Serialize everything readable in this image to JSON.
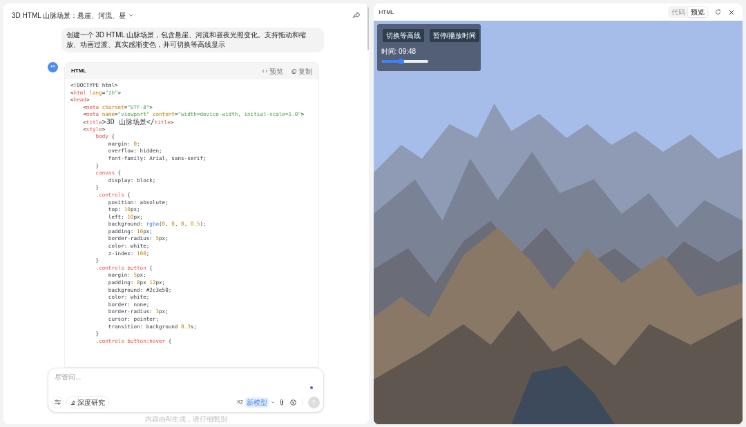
{
  "chat": {
    "title": "3D HTML 山脉场景：悬崖、河流、昼",
    "user_message": "创建一个 3D HTML 山脉场景，包含悬崖、河流和昼夜光照变化。支持拖动和缩放、动画过渡、真实感渐变色，并可切换等高线显示",
    "code_block": {
      "language": "HTML",
      "actions": [
        "预览",
        "复制"
      ],
      "lines": [
        [
          {
            "text": "<!DOCTYPE html>",
            "kind": "plain"
          }
        ],
        [
          {
            "text": "<",
            "kind": "plain"
          },
          {
            "text": "html",
            "kind": "tag"
          },
          {
            "text": " lang",
            "kind": "attr"
          },
          {
            "text": "=",
            "kind": "plain"
          },
          {
            "text": "\"zh\"",
            "kind": "string"
          },
          {
            "text": ">",
            "kind": "plain"
          }
        ],
        [
          {
            "text": "<",
            "kind": "plain"
          },
          {
            "text": "head",
            "kind": "tag"
          },
          {
            "text": ">",
            "kind": "plain"
          }
        ],
        [
          {
            "text": "    <",
            "kind": "plain"
          },
          {
            "text": "meta",
            "kind": "tag"
          },
          {
            "text": " charset",
            "kind": "attr"
          },
          {
            "text": "=",
            "kind": "plain"
          },
          {
            "text": "\"UTF-8\"",
            "kind": "string"
          },
          {
            "text": ">",
            "kind": "plain"
          }
        ],
        [
          {
            "text": "    <",
            "kind": "plain"
          },
          {
            "text": "meta",
            "kind": "tag"
          },
          {
            "text": " name",
            "kind": "attr"
          },
          {
            "text": "=",
            "kind": "plain"
          },
          {
            "text": "\"viewport\"",
            "kind": "string"
          },
          {
            "text": " content",
            "kind": "attr"
          },
          {
            "text": "=",
            "kind": "plain"
          },
          {
            "text": "\"width=device-width, initial-scale=1.0\"",
            "kind": "string"
          },
          {
            "text": ">",
            "kind": "plain"
          }
        ],
        [
          {
            "text": "    <",
            "kind": "plain"
          },
          {
            "text": "title",
            "kind": "tag"
          },
          {
            "text": ">3D 山脉场景</",
            "kind": "plain"
          },
          {
            "text": "title",
            "kind": "tag"
          },
          {
            "text": ">",
            "kind": "plain"
          }
        ],
        [
          {
            "text": "    <",
            "kind": "plain"
          },
          {
            "text": "style",
            "kind": "tag"
          },
          {
            "text": ">",
            "kind": "plain"
          }
        ],
        [
          {
            "text": "        body",
            "kind": "selector"
          },
          {
            "text": " {",
            "kind": "plain"
          }
        ],
        [
          {
            "text": "            margin: ",
            "kind": "plain"
          },
          {
            "text": "0",
            "kind": "number"
          },
          {
            "text": ";",
            "kind": "plain"
          }
        ],
        [
          {
            "text": "            overflow: hidden;",
            "kind": "plain"
          }
        ],
        [
          {
            "text": "            font-family: Arial, sans-serif;",
            "kind": "plain"
          }
        ],
        [
          {
            "text": "        }",
            "kind": "plain"
          }
        ],
        [
          {
            "text": "        canvas",
            "kind": "selector"
          },
          {
            "text": " {",
            "kind": "plain"
          }
        ],
        [
          {
            "text": "            display: block;",
            "kind": "plain"
          }
        ],
        [
          {
            "text": "        }",
            "kind": "plain"
          }
        ],
        [
          {
            "text": "        .controls",
            "kind": "selector"
          },
          {
            "text": " {",
            "kind": "plain"
          }
        ],
        [
          {
            "text": "            position: absolute;",
            "kind": "plain"
          }
        ],
        [
          {
            "text": "            top: ",
            "kind": "plain"
          },
          {
            "text": "10",
            "kind": "number"
          },
          {
            "text": "px;",
            "kind": "plain"
          }
        ],
        [
          {
            "text": "            left: ",
            "kind": "plain"
          },
          {
            "text": "10",
            "kind": "number"
          },
          {
            "text": "px;",
            "kind": "plain"
          }
        ],
        [
          {
            "text": "            background: ",
            "kind": "plain"
          },
          {
            "text": "rgba",
            "kind": "function"
          },
          {
            "text": "(",
            "kind": "plain"
          },
          {
            "text": "0",
            "kind": "number"
          },
          {
            "text": ", ",
            "kind": "plain"
          },
          {
            "text": "0",
            "kind": "number"
          },
          {
            "text": ", ",
            "kind": "plain"
          },
          {
            "text": "0",
            "kind": "number"
          },
          {
            "text": ", ",
            "kind": "plain"
          },
          {
            "text": "0.5",
            "kind": "number"
          },
          {
            "text": ");",
            "kind": "plain"
          }
        ],
        [
          {
            "text": "            padding: ",
            "kind": "plain"
          },
          {
            "text": "10",
            "kind": "number"
          },
          {
            "text": "px;",
            "kind": "plain"
          }
        ],
        [
          {
            "text": "            border-radius: ",
            "kind": "plain"
          },
          {
            "text": "5",
            "kind": "number"
          },
          {
            "text": "px;",
            "kind": "plain"
          }
        ],
        [
          {
            "text": "            color: white;",
            "kind": "plain"
          }
        ],
        [
          {
            "text": "            z-index: ",
            "kind": "plain"
          },
          {
            "text": "100",
            "kind": "number"
          },
          {
            "text": ";",
            "kind": "plain"
          }
        ],
        [
          {
            "text": "        }",
            "kind": "plain"
          }
        ],
        [
          {
            "text": "        .controls button",
            "kind": "selector"
          },
          {
            "text": " {",
            "kind": "plain"
          }
        ],
        [
          {
            "text": "            margin: ",
            "kind": "plain"
          },
          {
            "text": "5",
            "kind": "number"
          },
          {
            "text": "px;",
            "kind": "plain"
          }
        ],
        [
          {
            "text": "            padding: ",
            "kind": "plain"
          },
          {
            "text": "8",
            "kind": "number"
          },
          {
            "text": "px ",
            "kind": "plain"
          },
          {
            "text": "12",
            "kind": "number"
          },
          {
            "text": "px;",
            "kind": "plain"
          }
        ],
        [
          {
            "text": "            background: #2c3e50;",
            "kind": "plain"
          }
        ],
        [
          {
            "text": "            color: white;",
            "kind": "plain"
          }
        ],
        [
          {
            "text": "            border: none;",
            "kind": "plain"
          }
        ],
        [
          {
            "text": "            border-radius: ",
            "kind": "plain"
          },
          {
            "text": "3",
            "kind": "number"
          },
          {
            "text": "px;",
            "kind": "plain"
          }
        ],
        [
          {
            "text": "            cursor: pointer;",
            "kind": "plain"
          }
        ],
        [
          {
            "text": "            transition: background ",
            "kind": "plain"
          },
          {
            "text": "0.3",
            "kind": "number"
          },
          {
            "text": "s;",
            "kind": "plain"
          }
        ],
        [
          {
            "text": "        }",
            "kind": "plain"
          }
        ],
        [
          {
            "text": "        .controls button:hover",
            "kind": "selector"
          },
          {
            "text": " {",
            "kind": "plain"
          }
        ]
      ]
    },
    "composer": {
      "placeholder": "尽管问...",
      "research_button": "深度研究",
      "model": "K2",
      "model_badge": "新模型"
    },
    "disclaimer": "内容由AI生成，请仔细甄别"
  },
  "preview": {
    "title": "HTML",
    "tabs": [
      {
        "label": "代码",
        "selected": false
      },
      {
        "label": "预览",
        "selected": true
      }
    ],
    "controls": {
      "buttons": [
        "切换等高线",
        "暂停/播放时间"
      ],
      "time_label": "时间: 09:48",
      "time_slider": {
        "level": 0.43
      }
    }
  }
}
